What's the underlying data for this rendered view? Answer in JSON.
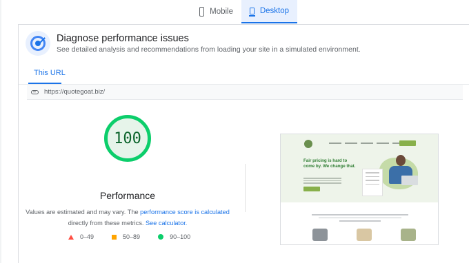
{
  "device_tabs": {
    "mobile_label": "Mobile",
    "desktop_label": "Desktop",
    "selected": "Desktop"
  },
  "header": {
    "title": "Diagnose performance issues",
    "subtitle": "See detailed analysis and recommendations from loading your site in a simulated environment."
  },
  "url_tab": {
    "label": "This URL"
  },
  "url": {
    "value": "https://quotegoat.biz/"
  },
  "score": {
    "value": "100",
    "category": "Performance",
    "color": "#0cce6b"
  },
  "note": {
    "prefix": "Values are estimated and may vary. The ",
    "link1": "performance score is calculated",
    "middle": "directly from these metrics. ",
    "link2": "See calculator."
  },
  "legend": [
    {
      "range": "0–49",
      "shape": "triangle",
      "color": "#ff4e42"
    },
    {
      "range": "50–89",
      "shape": "square",
      "color": "#ffa400"
    },
    {
      "range": "90–100",
      "shape": "circle",
      "color": "#0cce6b"
    }
  ],
  "thumbnail": {
    "headline": "Fair pricing is hard to come by. We change that."
  }
}
